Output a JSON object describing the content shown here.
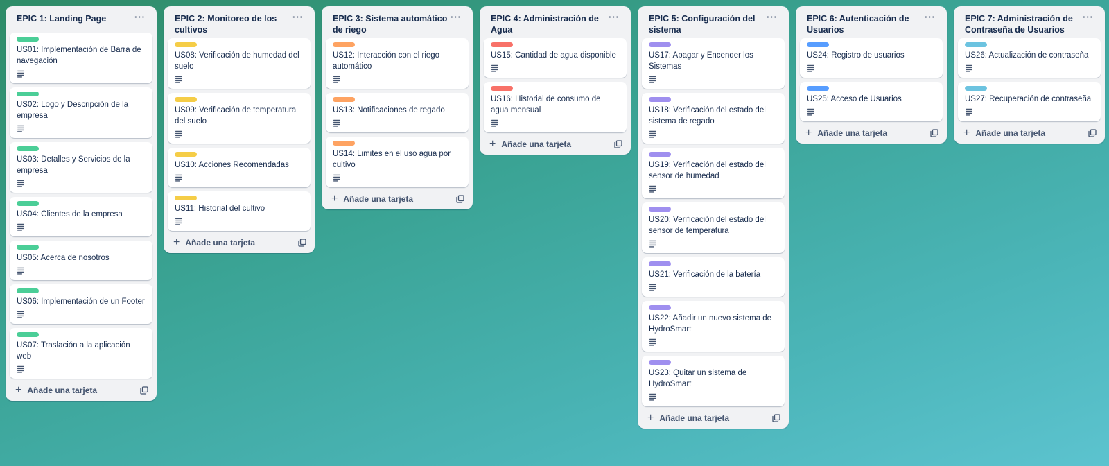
{
  "board": {
    "add_card_label": "Añade una tarjeta",
    "lists": [
      {
        "title": "EPIC 1: Landing Page",
        "label_color": "#4bce97",
        "cards": [
          "US01: Implementación de Barra de navegación",
          "US02: Logo y Descripción de la empresa",
          "US03: Detalles y Servicios de la empresa",
          "US04: Clientes de la empresa",
          "US05: Acerca de nosotros",
          "US06: Implementación de un Footer",
          "US07: Traslación a la aplicación web"
        ]
      },
      {
        "title": "EPIC 2: Monitoreo de los cultivos",
        "label_color": "#f5cd47",
        "cards": [
          "US08: Verificación de humedad del suelo",
          "US09: Verificación de temperatura del suelo",
          "US10: Acciones Recomendadas",
          "US11: Historial del cultivo"
        ]
      },
      {
        "title": "EPIC 3: Sistema automático de riego",
        "label_color": "#fea362",
        "cards": [
          "US12: Interacción con el riego automático",
          "US13: Notificaciones de regado",
          "US14: Limites en el uso agua por cultivo"
        ]
      },
      {
        "title": "EPIC 4: Administración de Agua",
        "label_color": "#f87168",
        "cards": [
          "US15: Cantidad de agua disponible",
          "US16: Historial de consumo de agua mensual"
        ]
      },
      {
        "title": "EPIC 5: Configuración del sistema",
        "label_color": "#9f8fef",
        "cards": [
          "US17: Apagar y Encender los Sistemas",
          "US18: Verificación del estado del sistema de regado",
          "US19: Verificación del estado del sensor de humedad",
          "US20: Verificación del estado del sensor de temperatura",
          "US21: Verificación de la batería",
          "US22: Añadir un nuevo sistema de HydroSmart",
          "US23: Quitar un sistema de HydroSmart"
        ]
      },
      {
        "title": "EPIC 6: Autenticación de Usuarios",
        "label_color": "#579dff",
        "cards": [
          "US24: Registro de usuarios",
          "US25: Acceso de Usuarios"
        ]
      },
      {
        "title": "EPIC 7: Administración de Contraseña de Usuarios",
        "label_color": "#6cc3e0",
        "cards": [
          "US26: Actualización de contraseña",
          "US27: Recuperación de contraseña"
        ]
      }
    ]
  }
}
